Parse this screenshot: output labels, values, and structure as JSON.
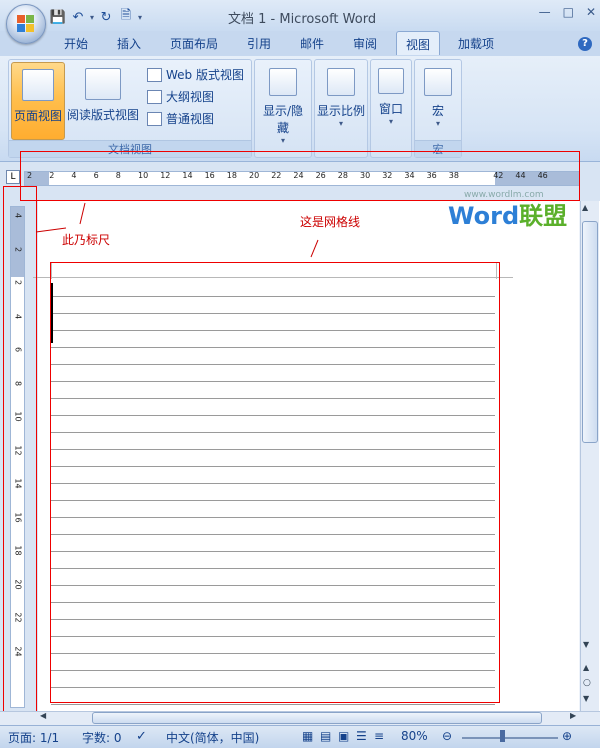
{
  "window": {
    "title": "文档 1 - Microsoft Word"
  },
  "tabs": [
    "开始",
    "插入",
    "页面布局",
    "引用",
    "邮件",
    "审阅",
    "视图",
    "加载项"
  ],
  "active_tab": "视图",
  "ribbon": {
    "doc_views": {
      "group_label": "文档视图",
      "print_layout": "页面视图",
      "reading": "阅读版式视图",
      "web": "Web 版式视图",
      "outline": "大纲视图",
      "draft": "普通视图"
    },
    "show_hide": {
      "label": "显示/隐藏"
    },
    "zoom": {
      "label": "显示比例"
    },
    "window": {
      "label": "窗口"
    },
    "macros": {
      "label": "宏",
      "group_label": "宏"
    }
  },
  "hruler_numbers": [
    "2",
    "2",
    "4",
    "6",
    "8",
    "10",
    "12",
    "14",
    "16",
    "18",
    "20",
    "22",
    "24",
    "26",
    "28",
    "30",
    "32",
    "34",
    "36",
    "38",
    "",
    "42",
    "44",
    "46"
  ],
  "vruler_numbers": [
    "4",
    "2",
    "2",
    "4",
    "6",
    "8",
    "10",
    "12",
    "14",
    "16",
    "18",
    "20",
    "22",
    "24"
  ],
  "tab_selector": "L",
  "annotations": {
    "ruler": "此乃标尺",
    "grid": "这是网格线"
  },
  "watermark": {
    "url": "www.wordlm.com",
    "brand_a": "Word",
    "brand_b": "联盟"
  },
  "status": {
    "page": "页面: 1/1",
    "words": "字数: 0",
    "lang": "中文(简体，中国)",
    "zoom": "80%"
  }
}
